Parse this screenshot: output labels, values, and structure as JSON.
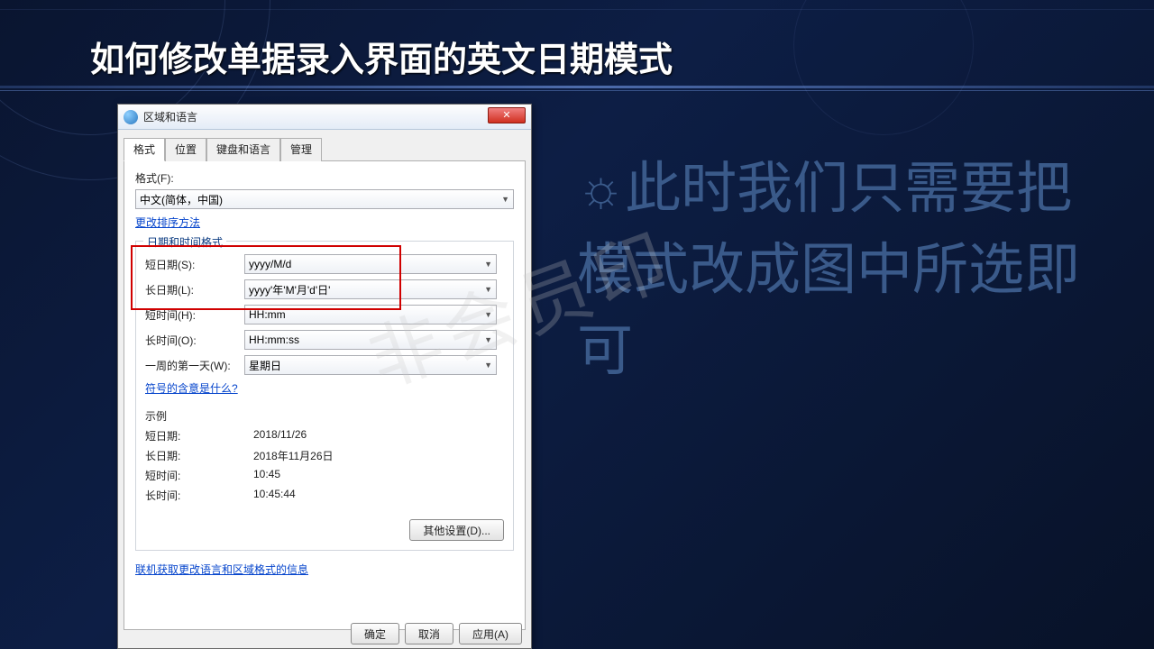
{
  "slide": {
    "title": "如何修改单据录入界面的英文日期模式",
    "side_text": "此时我们只需要把模式改成图中所选即可",
    "bullet_glyph": "☼",
    "watermark": "非会员印"
  },
  "dialog": {
    "window_title": "区域和语言",
    "close_x": "✕",
    "tabs": {
      "format": "格式",
      "location": "位置",
      "keyboard": "键盘和语言",
      "admin": "管理"
    },
    "format_label": "格式(F):",
    "format_value": "中文(简体，中国)",
    "sort_link": "更改排序方法",
    "datetime_group": "日期和时间格式",
    "rows": {
      "short_date_label": "短日期(S):",
      "short_date_value": "yyyy/M/d",
      "long_date_label": "长日期(L):",
      "long_date_value": "yyyy'年'M'月'd'日'",
      "short_time_label": "短时间(H):",
      "short_time_value": "HH:mm",
      "long_time_label": "长时间(O):",
      "long_time_value": "HH:mm:ss",
      "first_day_label": "一周的第一天(W):",
      "first_day_value": "星期日"
    },
    "symbol_link": "符号的含意是什么?",
    "example_title": "示例",
    "examples": {
      "short_date_label": "短日期:",
      "short_date_value": "2018/11/26",
      "long_date_label": "长日期:",
      "long_date_value": "2018年11月26日",
      "short_time_label": "短时间:",
      "short_time_value": "10:45",
      "long_time_label": "长时间:",
      "long_time_value": "10:45:44"
    },
    "other_settings": "其他设置(D)...",
    "online_link": "联机获取更改语言和区域格式的信息",
    "buttons": {
      "ok": "确定",
      "cancel": "取消",
      "apply": "应用(A)"
    }
  }
}
